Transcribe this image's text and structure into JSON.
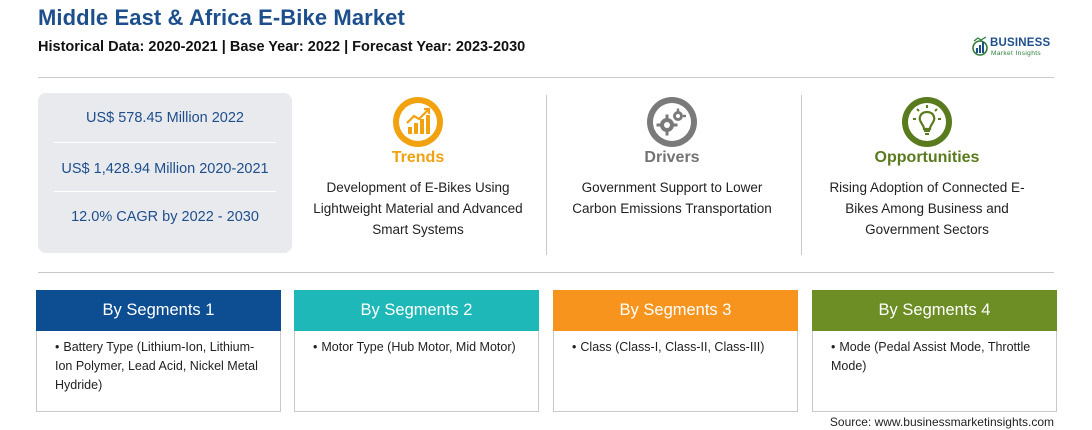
{
  "header": {
    "title": "Middle East & Africa E-Bike Market",
    "subtitle": "Historical Data: 2020-2021 | Base Year: 2022 | Forecast Year: 2023-2030"
  },
  "logo": {
    "main": "BUSINESS",
    "sub": "Market Insights"
  },
  "stats": [
    "US$ 578.45 Million 2022",
    "US$ 1,428.94 Million 2020-2021",
    "12.0% CAGR by 2022 - 2030"
  ],
  "columns": {
    "trends": {
      "title": "Trends",
      "text": "Development of E-Bikes Using Lightweight Material and Advanced Smart Systems",
      "color": "#f2a10f",
      "icon": "trend-chart-icon"
    },
    "drivers": {
      "title": "Drivers",
      "text": "Government Support to Lower Carbon Emissions Transportation",
      "color": "#737373",
      "icon": "gears-icon"
    },
    "opportunities": {
      "title": "Opportunities",
      "text": "Rising Adoption of Connected E-Bikes Among Business and Government Sectors",
      "color": "#5a7a1e",
      "icon": "lightbulb-icon"
    }
  },
  "segments": [
    {
      "title": "By Segments 1",
      "bullet": "•",
      "item": "Battery Type (Lithium-Ion, Lithium-Ion Polymer, Lead Acid, Nickel Metal Hydride)",
      "color": "#0d4d92"
    },
    {
      "title": "By Segments 2",
      "bullet": "•",
      "item": "Motor Type (Hub Motor, Mid Motor)",
      "color": "#1fb8b8"
    },
    {
      "title": "By Segments 3",
      "bullet": "•",
      "item": "Class (Class-I, Class-II, Class-III)",
      "color": "#f7941d"
    },
    {
      "title": "By Segments 4",
      "bullet": "•",
      "item": "Mode (Pedal Assist Mode, Throttle Mode)",
      "color": "#6c8e24"
    }
  ],
  "source": "Source: www.businessmarketinsights.com"
}
